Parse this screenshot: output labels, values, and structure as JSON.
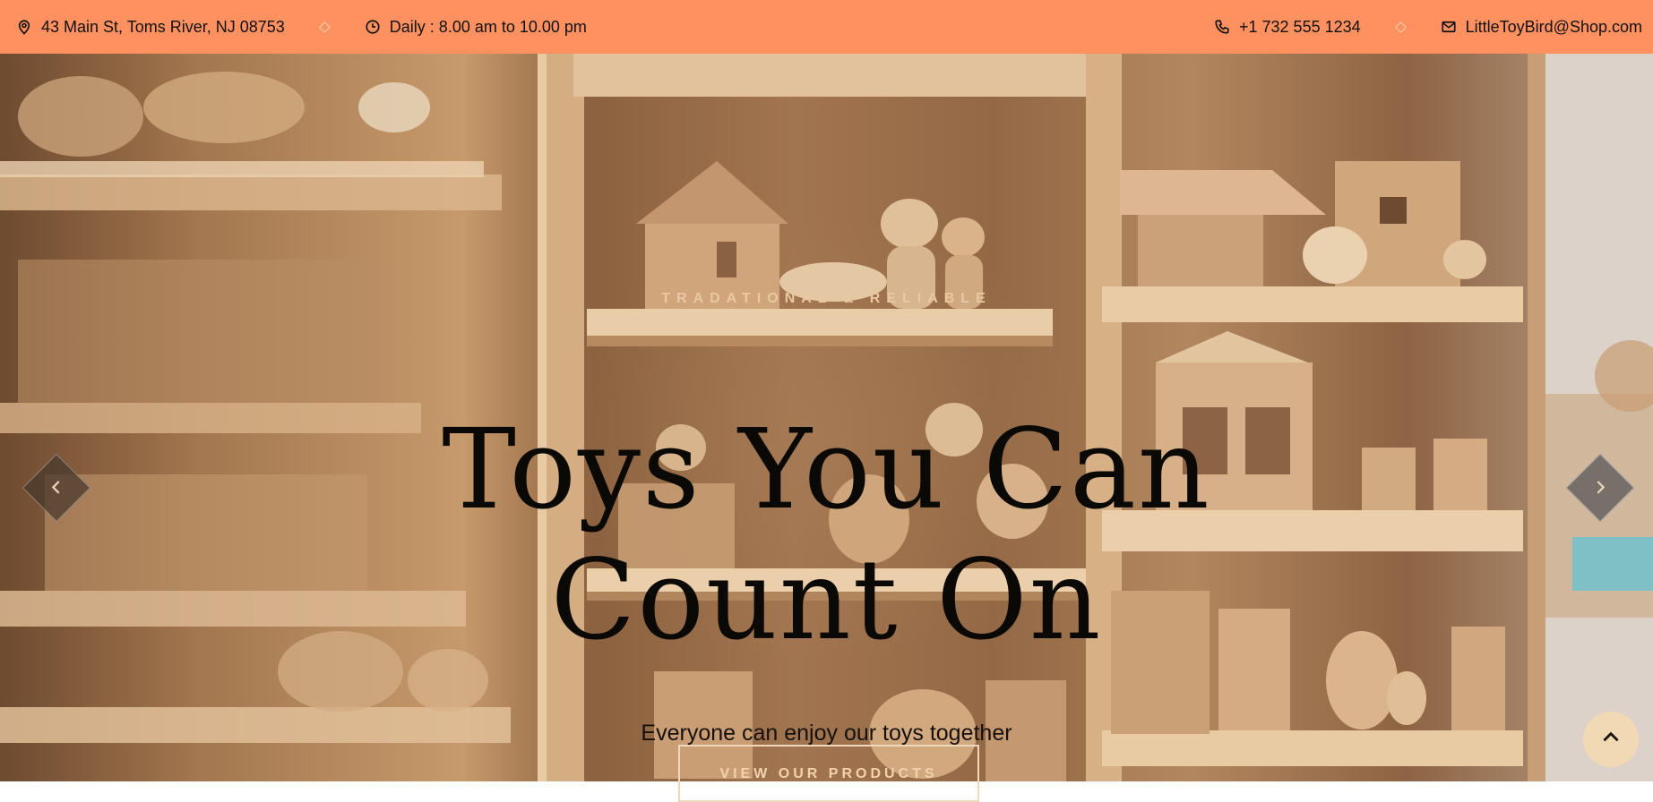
{
  "topbar": {
    "address": "43 Main St, Toms River, NJ 08753",
    "hours": "Daily : 8.00 am to 10.00 pm",
    "phone": "+1 732 555 1234",
    "email": "LittleToyBird@Shop.com",
    "background_color": "#ff9160",
    "icons": [
      "map-pin-icon",
      "clock-icon",
      "phone-icon",
      "mail-icon"
    ]
  },
  "hero": {
    "eyebrow": "TRADATIONAL & RELIABLE",
    "headline_line1": "Toys You Can",
    "headline_line2": "Count On",
    "subheadline": "Everyone can enjoy our toys together",
    "cta_label": "VIEW OUR PRODUCTS",
    "background_description_icon": "wooden-toy-shelves-image"
  },
  "controls": {
    "prev_icon": "chevron-left-icon",
    "next_icon": "chevron-right-icon",
    "back_to_top_icon": "chevron-up-icon"
  }
}
